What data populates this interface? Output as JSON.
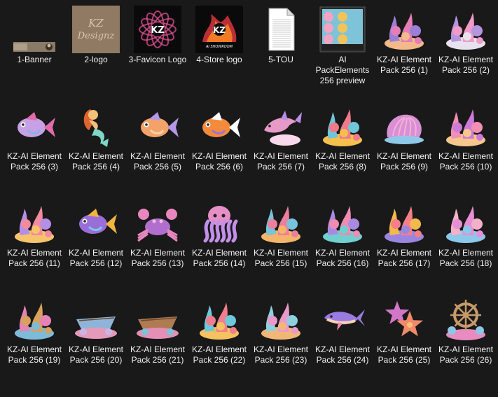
{
  "window_title": "",
  "files": [
    {
      "name": "1-Banner",
      "icon": "banner-thumbnail-icon",
      "kind": "banner",
      "palette": [
        "#3a3026",
        "#8a7a66",
        "#c9b79f"
      ]
    },
    {
      "name": "2-logo",
      "icon": "kz-designz-logo-icon",
      "kind": "logo-script",
      "logo_text": "KZ\nDesignz",
      "palette": [
        "#6e5b4a",
        "#a48b72",
        "#d9c6ad"
      ]
    },
    {
      "name": "3-Favicon Logo",
      "icon": "kz-favicon-logo-icon",
      "kind": "logo-swirl",
      "logo_text": "KZ",
      "palette": [
        "#0a0a0a",
        "#e8559a",
        "#ffffff"
      ]
    },
    {
      "name": "4-Store logo",
      "icon": "kz-store-logo-icon",
      "kind": "logo-fire",
      "logo_text": "KZ",
      "logo_subtext": "AI SHOWROOM",
      "palette": [
        "#0a0a0a",
        "#f07a25",
        "#d9363e"
      ]
    },
    {
      "name": "5-TOU",
      "icon": "text-document-icon",
      "kind": "document",
      "palette": [
        "#ffffff",
        "#dcdcdc",
        "#9a9a9a"
      ]
    },
    {
      "name": "AI PackElements 256 preview",
      "icon": "preview-collage-icon",
      "kind": "collage",
      "palette": [
        "#7ec3d8",
        "#f4a3c4",
        "#f0c45a"
      ]
    },
    {
      "name": "KZ-AI Element Pack 256 (1)",
      "icon": "coral-shell-icon",
      "kind": "reef",
      "palette": [
        "#e47eb8",
        "#9b7fd6",
        "#f3b98a"
      ]
    },
    {
      "name": "KZ-AI Element Pack 256 (2)",
      "icon": "coral-reef-icon",
      "kind": "reef",
      "palette": [
        "#f09bc8",
        "#b495e0",
        "#e8e2ef"
      ]
    },
    {
      "name": "KZ-AI Element Pack 256 (3)",
      "icon": "angler-fish-icon",
      "kind": "fish",
      "palette": [
        "#c8a0e6",
        "#e06cab",
        "#7db8e0"
      ]
    },
    {
      "name": "KZ-AI Element Pack 256 (4)",
      "icon": "mermaid-icon",
      "kind": "mermaid",
      "palette": [
        "#e0642f",
        "#f3c07a",
        "#7ed6c6"
      ]
    },
    {
      "name": "KZ-AI Element Pack 256 (5)",
      "icon": "goldfish-icon",
      "kind": "fish",
      "palette": [
        "#f3a36a",
        "#b697e6",
        "#f6d3a5"
      ]
    },
    {
      "name": "KZ-AI Element Pack 256 (6)",
      "icon": "clownfish-icon",
      "kind": "fish",
      "palette": [
        "#f48a3c",
        "#ffffff",
        "#9c73d6"
      ]
    },
    {
      "name": "KZ-AI Element Pack 256 (7)",
      "icon": "dolphin-icon",
      "kind": "dolphin",
      "palette": [
        "#e79ac7",
        "#b98ee6",
        "#f7d8ea"
      ]
    },
    {
      "name": "KZ-AI Element Pack 256 (8)",
      "icon": "coral-cluster-icon",
      "kind": "reef",
      "palette": [
        "#f07a8c",
        "#6ec6d8",
        "#f5c04e"
      ]
    },
    {
      "name": "KZ-AI Element Pack 256 (9)",
      "icon": "seashell-icon",
      "kind": "shell",
      "palette": [
        "#d98fd6",
        "#f3b2d3",
        "#8fc9e9"
      ]
    },
    {
      "name": "KZ-AI Element Pack 256 (10)",
      "icon": "coral-vase-icon",
      "kind": "reef",
      "palette": [
        "#cf7ad9",
        "#f18fb4",
        "#f5c78d"
      ]
    },
    {
      "name": "KZ-AI Element Pack 256 (11)",
      "icon": "sea-anemone-icon",
      "kind": "reef",
      "palette": [
        "#f28aa0",
        "#b58ee6",
        "#f7c46e"
      ]
    },
    {
      "name": "KZ-AI Element Pack 256 (12)",
      "icon": "tropical-fish-icon",
      "kind": "fish",
      "palette": [
        "#9a6ed9",
        "#f0b440",
        "#7ec9e6"
      ]
    },
    {
      "name": "KZ-AI Element Pack 256 (13)",
      "icon": "crab-icon",
      "kind": "crab",
      "palette": [
        "#b06fcf",
        "#e887bf",
        "#f2c1de"
      ]
    },
    {
      "name": "KZ-AI Element Pack 256 (14)",
      "icon": "octopus-icon",
      "kind": "octopus",
      "palette": [
        "#e68fc6",
        "#c290e8",
        "#f6c6a0"
      ]
    },
    {
      "name": "KZ-AI Element Pack 256 (15)",
      "icon": "reef-mound-icon",
      "kind": "reef",
      "palette": [
        "#ec7f9d",
        "#76c3dc",
        "#f4b56a"
      ]
    },
    {
      "name": "KZ-AI Element Pack 256 (16)",
      "icon": "reef-garden-icon",
      "kind": "reef",
      "palette": [
        "#f08bb4",
        "#a98ae3",
        "#6fd0cf"
      ]
    },
    {
      "name": "KZ-AI Element Pack 256 (17)",
      "icon": "flower-coral-icon",
      "kind": "reef",
      "palette": [
        "#f47f88",
        "#f4b94c",
        "#9a86e0"
      ]
    },
    {
      "name": "KZ-AI Element Pack 256 (18)",
      "icon": "tube-coral-icon",
      "kind": "reef",
      "palette": [
        "#e78fd4",
        "#f3b1c9",
        "#8cc8ea"
      ]
    },
    {
      "name": "KZ-AI Element Pack 256 (19)",
      "icon": "seaweed-reef-icon",
      "kind": "reef",
      "palette": [
        "#d8a15d",
        "#e583b6",
        "#7dbbd9"
      ]
    },
    {
      "name": "KZ-AI Element Pack 256 (20)",
      "icon": "shipwreck-icon",
      "kind": "boat",
      "palette": [
        "#8fb4d8",
        "#e49ab8",
        "#c9b6e6"
      ]
    },
    {
      "name": "KZ-AI Element Pack 256 (21)",
      "icon": "wooden-boat-icon",
      "kind": "boat",
      "palette": [
        "#b07a52",
        "#e38fb6",
        "#7ec2d5"
      ]
    },
    {
      "name": "KZ-AI Element Pack 256 (22)",
      "icon": "reef-castle-icon",
      "kind": "reef",
      "palette": [
        "#f07e8d",
        "#6ec8dc",
        "#f6c160"
      ]
    },
    {
      "name": "KZ-AI Element Pack 256 (23)",
      "icon": "shell-pile-icon",
      "kind": "reef",
      "palette": [
        "#e99acb",
        "#8fd0e0",
        "#f2b777"
      ]
    },
    {
      "name": "KZ-AI Element Pack 256 (24)",
      "icon": "whale-icon",
      "kind": "whale",
      "palette": [
        "#9a7be0",
        "#f28bb4",
        "#f7d4b0"
      ]
    },
    {
      "name": "KZ-AI Element Pack 256 (25)",
      "icon": "starfish-icon",
      "kind": "starfish",
      "palette": [
        "#f08a6a",
        "#d277c8",
        "#f6c07a"
      ]
    },
    {
      "name": "KZ-AI Element Pack 256 (26)",
      "icon": "ship-wheel-reef-icon",
      "kind": "wheel",
      "palette": [
        "#c69a6a",
        "#e78bc0",
        "#8ec6e6"
      ]
    }
  ]
}
